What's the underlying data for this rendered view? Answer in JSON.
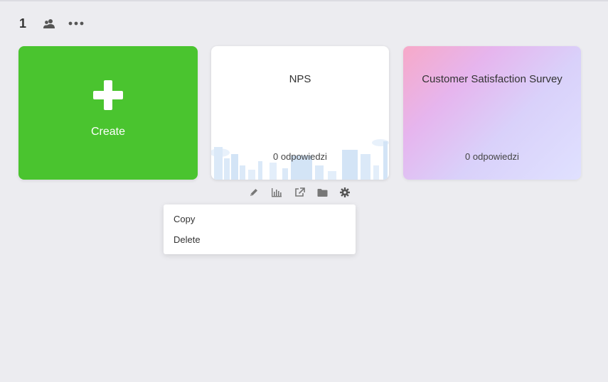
{
  "toolbar": {
    "page_number": "1",
    "share_icon": "users-icon",
    "more_icon": "more-horizontal-icon"
  },
  "cards": {
    "create": {
      "label": "Create",
      "icon": "plus-icon",
      "color": "#4ac42f"
    },
    "nps": {
      "title": "NPS",
      "responses": "0 odpowiedzi"
    },
    "css": {
      "title": "Customer Satisfaction Survey",
      "responses": "0 odpowiedzi"
    }
  },
  "card_actions": [
    "pencil-icon",
    "bar-chart-icon",
    "external-link-icon",
    "folder-icon",
    "gear-icon"
  ],
  "context_menu": {
    "items": [
      {
        "label": "Copy"
      },
      {
        "label": "Delete"
      }
    ]
  }
}
